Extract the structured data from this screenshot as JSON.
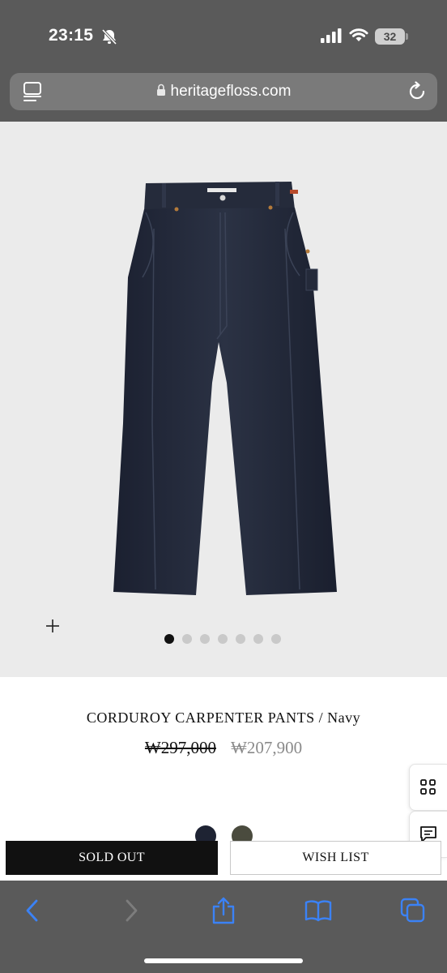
{
  "status_bar": {
    "time": "23:15",
    "battery_level": "32",
    "icons": [
      "bell-slash-icon",
      "cellular-signal-icon",
      "wifi-icon",
      "battery-icon"
    ]
  },
  "browser": {
    "url": "heritagefloss.com",
    "icons": [
      "tabs-overview-icon",
      "lock-icon",
      "reload-icon"
    ]
  },
  "gallery": {
    "image": "navy-corduroy-pants-photo",
    "zoom_icon": "plus-icon",
    "slide_count": 7,
    "active_slide": 1
  },
  "product": {
    "title": "CORDUROY CARPENTER PANTS / Navy",
    "original_price": "₩297,000",
    "sale_price": "₩207,900",
    "color_swatches": [
      {
        "name": "navy",
        "color": "#1e2333"
      },
      {
        "name": "olive",
        "color": "#4a4b3e"
      }
    ]
  },
  "side_tabs": [
    "grid-icon",
    "chat-icon"
  ],
  "actions": {
    "sold_out_label": "SOLD OUT",
    "wish_list_label": "WISH LIST"
  },
  "toolbar": {
    "icons": [
      "back-icon",
      "forward-icon",
      "share-icon",
      "bookmarks-icon",
      "tabs-icon"
    ],
    "accent_color": "#3b82f6"
  }
}
